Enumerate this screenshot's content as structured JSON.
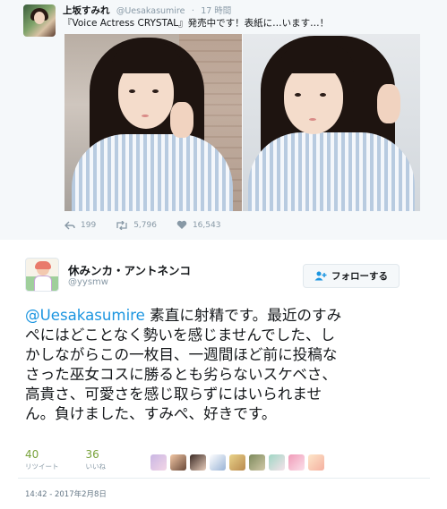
{
  "tweet1": {
    "display_name": "上坂すみれ",
    "handle": "@Uesakasumire",
    "time": "17 時間",
    "text": "『Voice Actress CRYSTAL』発売中です！表紙に…います…！",
    "replies": "199",
    "retweets": "5,796",
    "likes": "16,543"
  },
  "tweet2": {
    "display_name": "休みンカ・アントネンコ",
    "handle": "@yysmw",
    "follow_label": "フォローする",
    "mention": "@Uesakasumire",
    "body_lines": [
      " 素直に射精です。最近のすみ",
      "ぺにはどことなく勢いを感じませんでした、し",
      "かしながらこの一枚目、一週間ほど前に投稿な",
      "さった巫女コスに勝るとも劣らないスケベさ、",
      "高貴さ、可愛さを感じ取らずにはいられませ",
      "ん。負けました、すみぺ、好きです。"
    ],
    "retweet_count": "40",
    "retweet_label": "リツイート",
    "like_count": "36",
    "like_label": "いいね",
    "timestamp": "14:42 - 2017年2月8日"
  },
  "colors": {
    "link_blue": "#1b95e0",
    "count_green": "#78a23a",
    "muted_gray": "#8899a6"
  },
  "icons": [
    "reply-icon",
    "retweet-icon",
    "heart-icon",
    "follow-person-icon"
  ]
}
